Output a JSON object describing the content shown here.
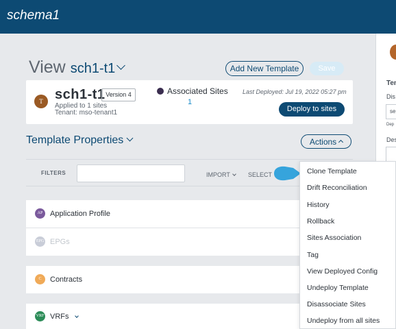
{
  "app": {
    "title": "schema1"
  },
  "view": {
    "label": "View",
    "schema_name": "sch1-t1",
    "add_template_label": "Add New Template",
    "save_label": "Save"
  },
  "template_card": {
    "avatar_letter": "T",
    "name": "sch1-t1",
    "version": "Version 4",
    "applied": "Applied to 1 sites",
    "tenant": "Tenant: mso-tenant1",
    "assoc_label": "Associated Sites",
    "assoc_count": "1",
    "last_deployed": "Last Deployed: Jul 19, 2022 05:27 pm",
    "deploy_label": "Deploy to sites"
  },
  "properties": {
    "title": "Template Properties",
    "actions_label": "Actions"
  },
  "filters": {
    "label": "FILTERS",
    "input_value": "",
    "import_label": "IMPORT",
    "select_label": "SELECT"
  },
  "rows": [
    {
      "icon_text": "AP",
      "label": "Application Profile",
      "icon_color": "#7b5a9c",
      "label_color": "#2b3138"
    },
    {
      "icon_text": "EPG",
      "label": "EPGs",
      "icon_color": "#c9cdd8",
      "label_color": "#c2c7cd"
    },
    {
      "icon_text": "C",
      "label": "Contracts",
      "icon_color": "#f0aa58",
      "label_color": "#2b3138"
    },
    {
      "icon_text": "VRF",
      "label": "VRFs",
      "icon_color": "#2c8c58",
      "label_color": "#2b3138"
    }
  ],
  "menu": {
    "items": [
      "Clone Template",
      "Drift Reconciliation",
      "History",
      "Rollback",
      "Sites Association",
      "Tag",
      "View Deployed Config",
      "Undeploy Template",
      "Disassociate Sites",
      "Undeploy from all sites"
    ]
  },
  "right_panel": {
    "heading": "Ten",
    "field1_label": "Dis",
    "field1_value": "se",
    "field1_hint": "Dep",
    "field2_label": "Des"
  },
  "colors": {
    "brand": "#0d4a73",
    "link": "#1a8bc8",
    "pointer": "#36a4dc",
    "background": "#e7e9ec"
  }
}
